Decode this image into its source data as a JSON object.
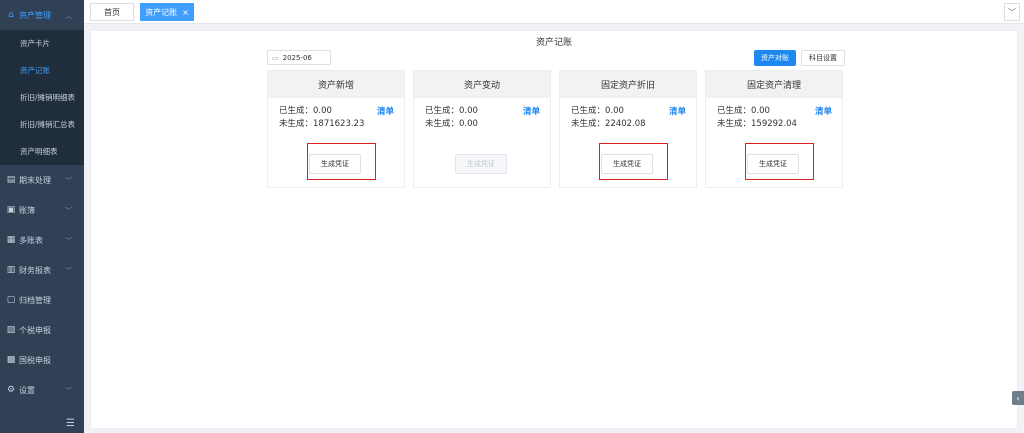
{
  "sidebar": {
    "groups": [
      {
        "label": "资产管理",
        "icon": "home-icon",
        "expanded": true
      },
      {
        "label": "期末处理",
        "icon": "calendar-icon"
      },
      {
        "label": "账簿",
        "icon": "book-icon"
      },
      {
        "label": "多账表",
        "icon": "table-icon"
      },
      {
        "label": "财务报表",
        "icon": "bar-chart-icon"
      },
      {
        "label": "归档管理",
        "icon": "archive-icon"
      },
      {
        "label": "个税申报",
        "icon": "id-card-icon"
      },
      {
        "label": "国税申报",
        "icon": "grid-icon"
      },
      {
        "label": "设置",
        "icon": "gear-icon"
      }
    ],
    "sub_items": [
      {
        "label": "资产卡片"
      },
      {
        "label": "资产记账",
        "active": true
      },
      {
        "label": "折旧/摊销明细表"
      },
      {
        "label": "折旧/摊销汇总表"
      },
      {
        "label": "资产明细表"
      }
    ]
  },
  "tabs": {
    "home": "首页",
    "current": "资产记账",
    "close": "×"
  },
  "main": {
    "title": "资产记账",
    "period": "2025-06",
    "reconcile_button": "资产对账",
    "subject_settings_button": "科目设置"
  },
  "cards": [
    {
      "title": "资产新增",
      "generated": "已生成：0.00",
      "ungenerated": "未生成：1871623.23",
      "detail": "清单",
      "button": "生成凭证",
      "enabled": true,
      "highlighted": true
    },
    {
      "title": "资产变动",
      "generated": "已生成：0.00",
      "ungenerated": "未生成：0.00",
      "detail": "清单",
      "button": "生成凭证",
      "enabled": false,
      "highlighted": false
    },
    {
      "title": "固定资产折旧",
      "generated": "已生成：0.00",
      "ungenerated": "未生成：22402.08",
      "detail": "清单",
      "button": "生成凭证",
      "enabled": true,
      "highlighted": true
    },
    {
      "title": "固定资产清理",
      "generated": "已生成：0.00",
      "ungenerated": "未生成：159292.04",
      "detail": "清单",
      "button": "生成凭证",
      "enabled": true,
      "highlighted": true
    }
  ],
  "colors": {
    "sidebar_bg": "#304156",
    "accent": "#1e87f0",
    "highlight": "#e02020"
  }
}
